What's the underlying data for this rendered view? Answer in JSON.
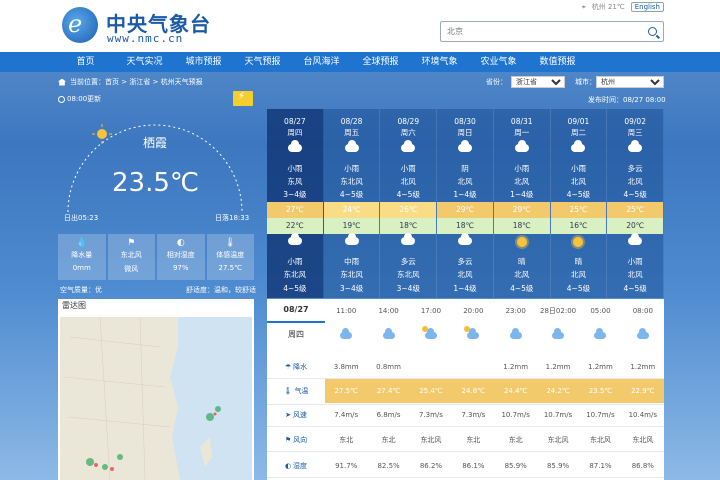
{
  "header": {
    "logo_text": "中央气象台",
    "logo_url": "www.nmc.cn",
    "top_weather": "杭州 21℃",
    "lang_label": "English",
    "search_placeholder": "北京"
  },
  "nav": [
    "首页",
    "天气实况",
    "城市预报",
    "天气预报",
    "台风海洋",
    "全球预报",
    "环境气象",
    "农业气象",
    "数值预报"
  ],
  "location": {
    "breadcrumb": "当前位置：首页 > 浙江省 > 杭州天气预报",
    "province_label": "省份：",
    "province_value": "浙江省",
    "city_label": "城市：",
    "city_value": "杭州"
  },
  "update": {
    "left": "08:00更新",
    "right": "发布时间：08/27 08:00"
  },
  "current": {
    "city": "栖霞",
    "temperature": "23.5℃",
    "sunrise": "日出05:23",
    "sunset": "日落18:33",
    "metrics": [
      {
        "icon": "raindrop-icon",
        "glyph": "💧",
        "label": "降水量",
        "value": "0mm"
      },
      {
        "icon": "wind-icon",
        "glyph": "⚑",
        "label": "东北风",
        "value": "微风"
      },
      {
        "icon": "humidity-icon",
        "glyph": "◐",
        "label": "相对湿度",
        "value": "97%"
      },
      {
        "icon": "thermometer-icon",
        "glyph": "🌡",
        "label": "体感温度",
        "value": "27.5℃"
      }
    ],
    "air_quality": "空气质量：优",
    "comfort": "舒适度：温和，较舒适"
  },
  "radar": {
    "title": "雷达图"
  },
  "forecast": [
    {
      "date": "08/27",
      "week": "周四",
      "icon1": "cloud-rain",
      "wx1": "小雨",
      "wind1": "东风",
      "level1": "3~4级",
      "high": "27℃",
      "low": "22℃",
      "icon2": "cloud-rain",
      "wx2": "小雨",
      "wind2": "东北风",
      "level2": "4~5级"
    },
    {
      "date": "08/28",
      "week": "周五",
      "icon1": "cloud-rain",
      "wx1": "小雨",
      "wind1": "东北风",
      "level1": "4~5级",
      "high": "24℃",
      "low": "19℃",
      "icon2": "cloud-rain",
      "wx2": "中雨",
      "wind2": "东北风",
      "level2": "3~4级"
    },
    {
      "date": "08/29",
      "week": "周六",
      "icon1": "cloud-rain",
      "wx1": "小雨",
      "wind1": "北风",
      "level1": "4~5级",
      "high": "26℃",
      "low": "18℃",
      "icon2": "partly-cloudy",
      "wx2": "多云",
      "wind2": "东北风",
      "level2": "3~4级"
    },
    {
      "date": "08/30",
      "week": "周日",
      "icon1": "cloud",
      "wx1": "阴",
      "wind1": "北风",
      "level1": "1~4级",
      "high": "29℃",
      "low": "18℃",
      "icon2": "partly-cloudy",
      "wx2": "多云",
      "wind2": "北风",
      "level2": "1~4级"
    },
    {
      "date": "08/31",
      "week": "周一",
      "icon1": "cloud-rain",
      "wx1": "小雨",
      "wind1": "北风",
      "level1": "1~4级",
      "high": "29℃",
      "low": "18℃",
      "icon2": "sun",
      "wx2": "晴",
      "wind2": "北风",
      "level2": "4~5级"
    },
    {
      "date": "09/01",
      "week": "周二",
      "icon1": "cloud-rain",
      "wx1": "小雨",
      "wind1": "北风",
      "level1": "4~5级",
      "high": "25℃",
      "low": "16℃",
      "icon2": "sun",
      "wx2": "晴",
      "wind2": "北风",
      "level2": "4~5级"
    },
    {
      "date": "09/02",
      "week": "周三",
      "icon1": "partly-cloudy",
      "wx1": "多云",
      "wind1": "北风",
      "level1": "4~5级",
      "high": "25℃",
      "low": "20℃",
      "icon2": "cloud-rain",
      "wx2": "小雨",
      "wind2": "北风",
      "level2": "4~5级"
    }
  ],
  "hourly": {
    "date": "08/27",
    "week": "周四",
    "times": [
      "11:00",
      "14:00",
      "17:00",
      "20:00",
      "23:00",
      "28日02:00",
      "05:00",
      "08:00"
    ],
    "icons": [
      "cloud-rain",
      "cloud-rain",
      "partly-cloudy",
      "partly-cloudy",
      "cloud-rain",
      "cloud-rain",
      "cloud-rain",
      "cloud-rain"
    ],
    "rows": [
      {
        "icon": "raindrop-icon",
        "label": "降水",
        "values": [
          "3.8mm",
          "0.8mm",
          "",
          "",
          "1.2mm",
          "1.2mm",
          "1.2mm",
          "1.2mm"
        ]
      },
      {
        "icon": "thermometer-icon",
        "label": "气温",
        "values": [
          "27.5℃",
          "27.4℃",
          "25.4℃",
          "24.8℃",
          "24.4℃",
          "24.2℃",
          "23.5℃",
          "22.9℃"
        ]
      },
      {
        "icon": "windspeed-icon",
        "label": "风速",
        "values": [
          "7.4m/s",
          "6.8m/s",
          "7.3m/s",
          "7.3m/s",
          "10.7m/s",
          "10.7m/s",
          "10.7m/s",
          "10.4m/s"
        ]
      },
      {
        "icon": "winddir-icon",
        "label": "风向",
        "values": [
          "东北",
          "东北",
          "东北风",
          "东北",
          "东北",
          "东北风",
          "东北风",
          "东北风"
        ]
      },
      {
        "icon": "humidity-icon",
        "label": "湿度",
        "values": [
          "91.7%",
          "82.5%",
          "86.2%",
          "86.1%",
          "85.9%",
          "85.9%",
          "87.1%",
          "86.8%"
        ]
      }
    ]
  },
  "colors": {
    "nav": "#1f74cf",
    "brand": "#1c5aa8",
    "high_temp": "#f2c96b",
    "low_temp": "#d8f0c2"
  }
}
